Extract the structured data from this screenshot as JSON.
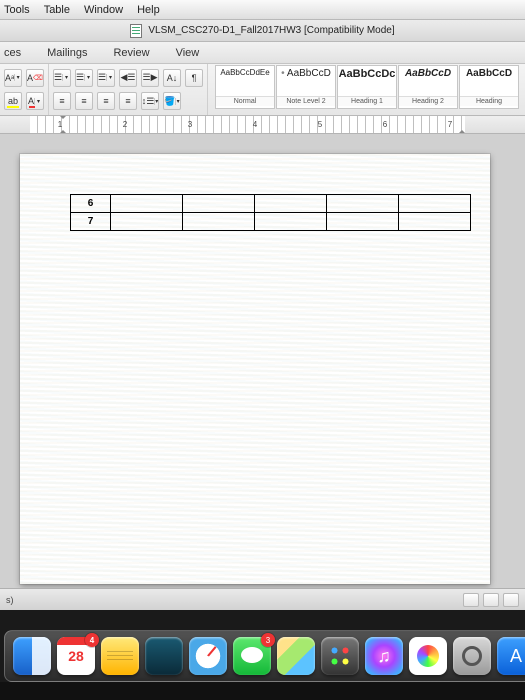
{
  "menubar": [
    "Tools",
    "Table",
    "Window",
    "Help"
  ],
  "title": "VLSM_CSC270-D1_Fall2017HW3 [Compatibility Mode]",
  "tabs": [
    "ces",
    "Mailings",
    "Review",
    "View"
  ],
  "styles": [
    {
      "preview": "AaBbCcDdEe",
      "label": "Normal"
    },
    {
      "preview": "AaBbCcD",
      "label": "Note Level 2"
    },
    {
      "preview": "AaBbCcDc",
      "label": "Heading 1"
    },
    {
      "preview": "AaBbCcD",
      "label": "Heading 2"
    },
    {
      "preview": "AaBbCcD",
      "label": "Heading"
    }
  ],
  "ruler_numbers": [
    "1",
    "2",
    "3",
    "4",
    "5",
    "6",
    "7"
  ],
  "table_rows": [
    {
      "num": "6"
    },
    {
      "num": "7"
    }
  ],
  "status_left": "s)",
  "calendar_day": "28",
  "messages_badge": "3",
  "calendar_badge": "4"
}
